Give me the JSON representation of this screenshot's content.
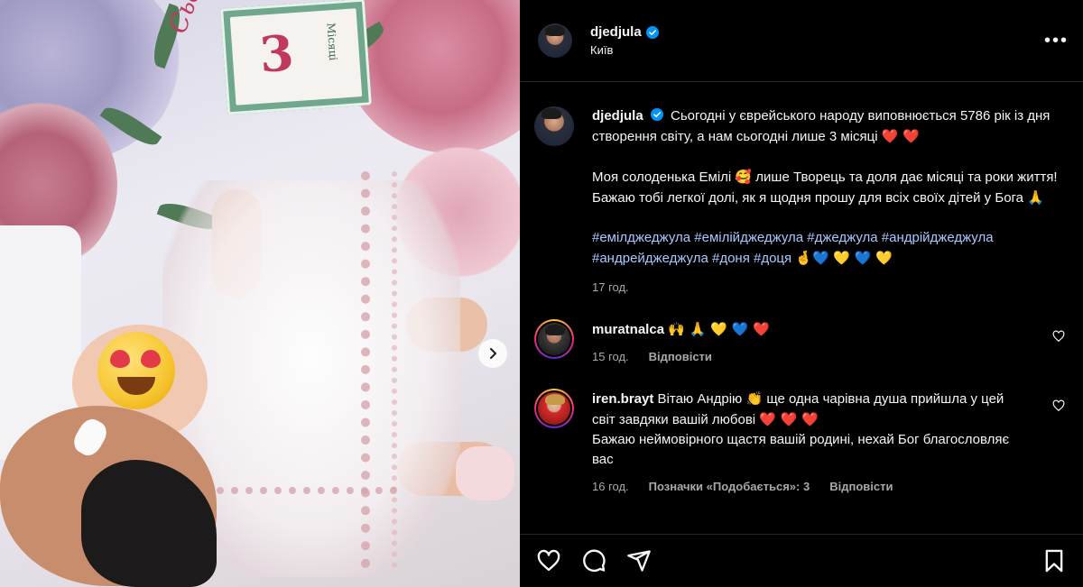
{
  "post": {
    "author": "djedjula",
    "location": "Київ",
    "more_label": "•••",
    "caption": {
      "p1": "Сьогодні у єврейського народу виповнюється 5786 рік із дня створення світу, а нам сьогодні лише 3 місяці",
      "p1_emoji": "❤️ ❤️",
      "p2": "Моя солоденька Емілі",
      "p2_emoji": "🥰",
      "p2_rest": "лише Творець та доля дає місяці та роки життя! Бажаю тобі легкої долі, як я щодня прошу для всіх своїх дітей у Бога",
      "p2_end_emoji": "🙏",
      "hashtags_line1": "#емілджеджула #емілійджеджула #джеджула #андрійджеджула",
      "hashtags_line2": "#андрейджеджула #доня #доця",
      "hashtags_emoji": "🤞💙 💛 💙 💛"
    },
    "time": "17 год."
  },
  "media": {
    "card_number": "3",
    "card_text": "Місяці",
    "script_text": "Сьогодні мені..."
  },
  "comments": [
    {
      "user": "muratnalca",
      "text": "",
      "emoji": "🙌 🙏 💛 💙 ❤️",
      "time": "15 год.",
      "reply": "Відповісти"
    },
    {
      "user": "iren.brayt",
      "text_a": "Вітаю Андрію",
      "emoji_a": "👏",
      "text_b": "ще одна чарівна душа прийшла у цей світ завдяки вашій любові",
      "emoji_b": "❤️ ❤️ ❤️",
      "text_c": "Бажаю неймовірного щастя вашій родині, нехай Бог благословляє вас",
      "time": "16 год.",
      "likes": "Позначки «Подобається»: 3",
      "reply": "Відповісти"
    }
  ],
  "icons": {
    "like": "heart-icon",
    "comment": "comment-icon",
    "share": "send-icon",
    "save": "bookmark-icon"
  },
  "colors": {
    "background": "#000000",
    "text": "#f5f5f5",
    "muted": "#a8a8a8",
    "link": "#a9c8ff",
    "verified": "#0095f6"
  }
}
